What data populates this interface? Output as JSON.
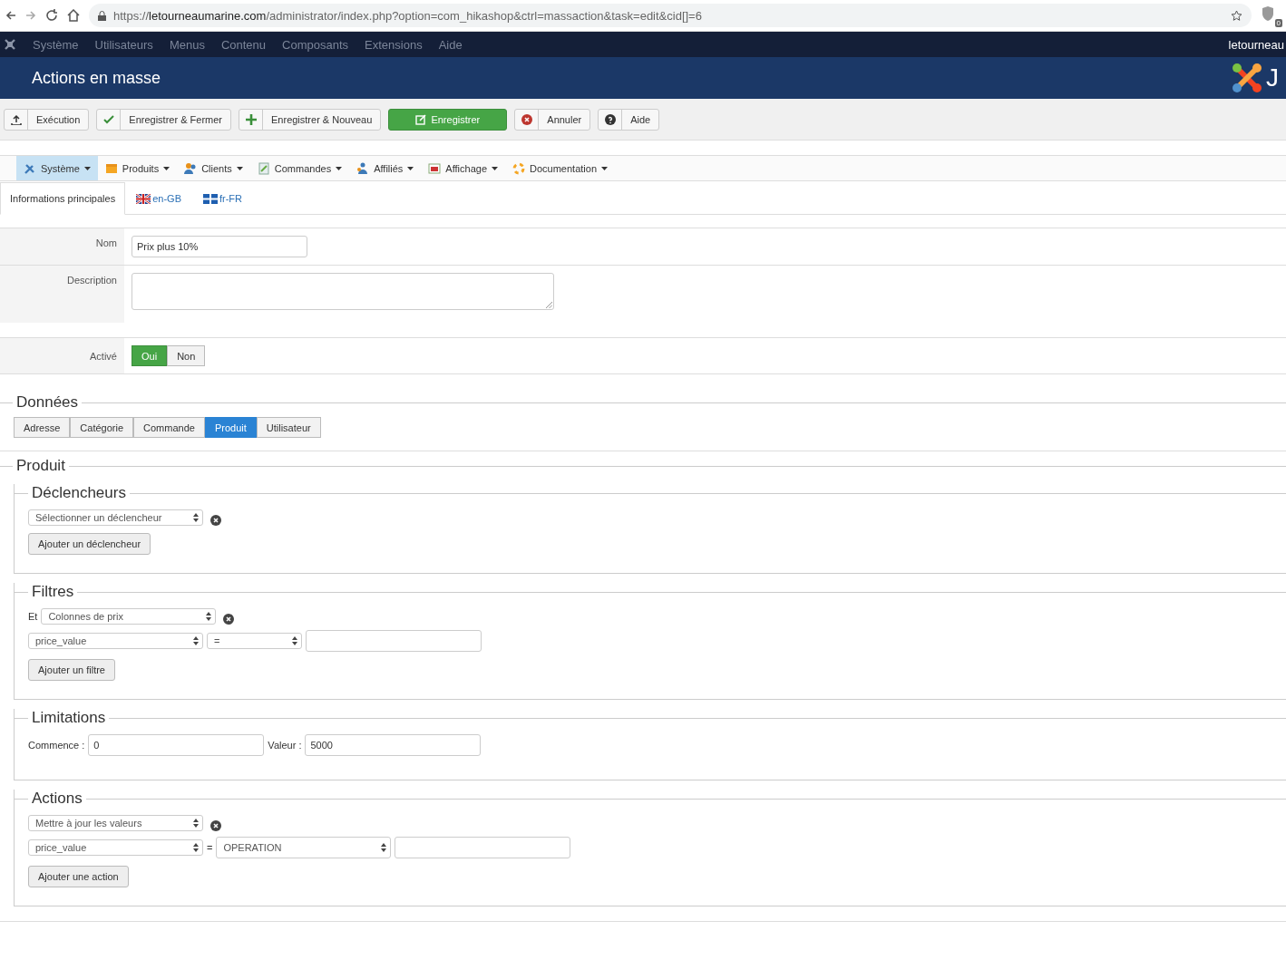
{
  "browser": {
    "url_scheme": "https://",
    "url_host": "letourneaumarine.com",
    "url_path": "/administrator/index.php?option=com_hikashop&ctrl=massaction&task=edit&cid[]=6",
    "extension_badge": "0"
  },
  "top_menu": {
    "items": [
      "Système",
      "Utilisateurs",
      "Menus",
      "Contenu",
      "Composants",
      "Extensions",
      "Aide"
    ],
    "user": "letourneau"
  },
  "header": {
    "title": "Actions en masse",
    "logo_text": "J"
  },
  "toolbar": [
    {
      "kind": "upload",
      "label": "Exécution",
      "primary": false
    },
    {
      "kind": "check",
      "label": "Enregistrer & Fermer",
      "primary": false
    },
    {
      "kind": "plus",
      "label": "Enregistrer & Nouveau",
      "primary": false
    },
    {
      "kind": "edit",
      "label": "Enregistrer",
      "primary": true
    },
    {
      "kind": "cancel",
      "label": "Annuler",
      "primary": false
    },
    {
      "kind": "help",
      "label": "Aide",
      "primary": false
    }
  ],
  "shop_menu": [
    {
      "kind": "tools",
      "label": "Système",
      "selected": true
    },
    {
      "kind": "box",
      "label": "Produits",
      "selected": false
    },
    {
      "kind": "users",
      "label": "Clients",
      "selected": false
    },
    {
      "kind": "doc",
      "label": "Commandes",
      "selected": false
    },
    {
      "kind": "affiliate",
      "label": "Affiliés",
      "selected": false
    },
    {
      "kind": "display",
      "label": "Affichage",
      "selected": false
    },
    {
      "kind": "help",
      "label": "Documentation",
      "selected": false
    }
  ],
  "lang_tabs": [
    {
      "kind": "plain",
      "label": "Informations principales",
      "selected": true
    },
    {
      "kind": "uk",
      "label": "en-GB",
      "selected": false
    },
    {
      "kind": "qc",
      "label": "fr-FR",
      "selected": false
    }
  ],
  "form": {
    "name": {
      "label": "Nom",
      "value": "Prix plus 10%"
    },
    "description": {
      "label": "Description"
    },
    "active": {
      "label": "Activé",
      "options": [
        {
          "label": "Oui",
          "selected": true
        },
        {
          "label": "Non",
          "selected": false
        }
      ]
    }
  },
  "data": {
    "title": "Données",
    "tabs": [
      {
        "label": "Adresse",
        "selected": false
      },
      {
        "label": "Catégorie",
        "selected": false
      },
      {
        "label": "Commande",
        "selected": false
      },
      {
        "label": "Produit",
        "selected": true
      },
      {
        "label": "Utilisateur",
        "selected": false
      }
    ]
  },
  "product": {
    "title": "Produit",
    "sections": [
      {
        "title": "Déclencheurs",
        "rows": [
          {
            "items": [
              {
                "kind": "select",
                "value": "Sélectionner un déclencheur"
              },
              {
                "kind": "remove"
              }
            ]
          }
        ],
        "button": "Ajouter un déclencheur"
      },
      {
        "title": "Filtres",
        "rows": [
          {
            "items": [
              {
                "kind": "label",
                "text": "Et"
              },
              {
                "kind": "select",
                "value": "Colonnes de prix"
              },
              {
                "kind": "remove"
              }
            ]
          },
          {
            "items": [
              {
                "kind": "select",
                "value": "price_value"
              },
              {
                "kind": "select_small",
                "value": "="
              },
              {
                "kind": "input"
              }
            ]
          }
        ],
        "button": "Ajouter un filtre"
      },
      {
        "title": "Limitations",
        "rows": [
          {
            "items": [
              {
                "kind": "label",
                "text": "Commence :"
              },
              {
                "kind": "input",
                "value": "0"
              },
              {
                "kind": "label",
                "text": "Valeur :"
              },
              {
                "kind": "input",
                "value": "5000"
              }
            ]
          }
        ]
      },
      {
        "title": "Actions",
        "rows": [
          {
            "items": [
              {
                "kind": "select",
                "value": "Mettre à jour les valeurs"
              },
              {
                "kind": "remove"
              }
            ]
          },
          {
            "items": [
              {
                "kind": "select",
                "value": "price_value"
              },
              {
                "kind": "label",
                "text": "="
              },
              {
                "kind": "select_wide",
                "value": "OPERATION"
              },
              {
                "kind": "input"
              }
            ]
          }
        ],
        "button": "Ajouter une action"
      }
    ]
  }
}
